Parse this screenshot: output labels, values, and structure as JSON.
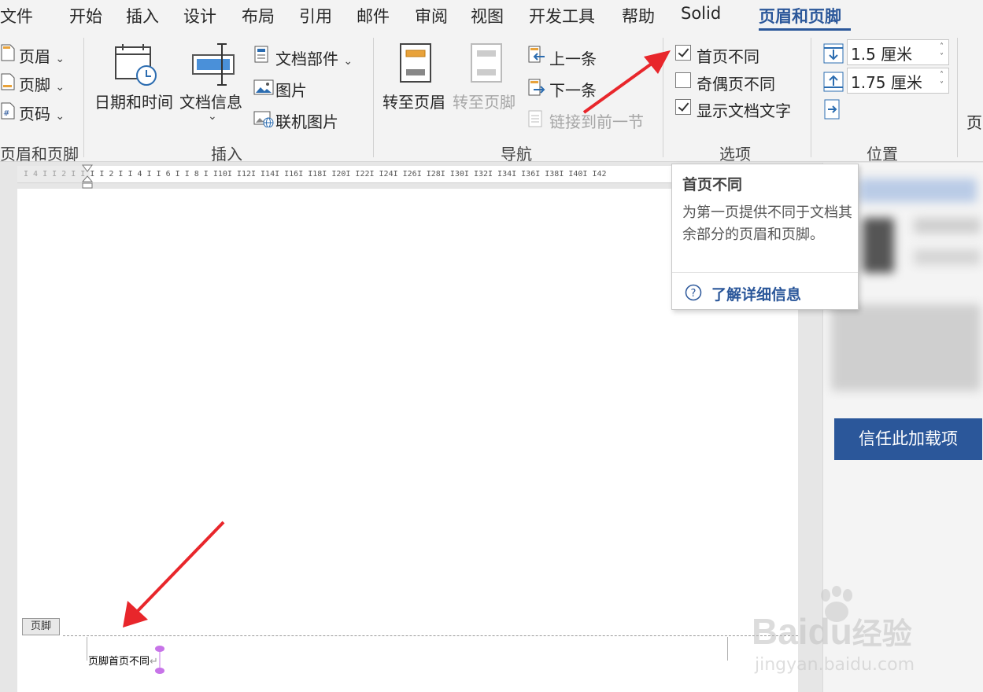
{
  "tabs": [
    {
      "label": "文件"
    },
    {
      "label": "开始"
    },
    {
      "label": "插入"
    },
    {
      "label": "设计"
    },
    {
      "label": "布局"
    },
    {
      "label": "引用"
    },
    {
      "label": "邮件"
    },
    {
      "label": "审阅"
    },
    {
      "label": "视图"
    },
    {
      "label": "开发工具"
    },
    {
      "label": "帮助"
    },
    {
      "label": "Solid"
    },
    {
      "label": "页眉和页脚",
      "active": true
    }
  ],
  "ribbon": {
    "hf_group": {
      "header": "页眉",
      "footer": "页脚",
      "page_number": "页码",
      "label": "页眉和页脚"
    },
    "insert_group": {
      "date_time": "日期和时间",
      "doc_info": "文档信息",
      "quick_parts": "文档部件",
      "picture": "图片",
      "online_picture": "联机图片",
      "label": "插入"
    },
    "nav_group": {
      "goto_header": "转至页眉",
      "goto_footer": "转至页脚",
      "previous": "上一条",
      "next": "下一条",
      "link_previous": "链接到前一节",
      "label": "导航"
    },
    "options_group": {
      "different_first": "首页不同",
      "different_odd_even": "奇偶页不同",
      "show_doc_text": "显示文档文字",
      "label": "选项"
    },
    "position_group": {
      "header_from_top": "1.5 厘米",
      "footer_from_bottom": "1.75 厘米",
      "label": "位置"
    },
    "close_partial": "页"
  },
  "options_state": {
    "different_first": true,
    "different_odd_even": false,
    "show_doc_text": true
  },
  "ruler": {
    "marks": "I 4 I   I 2 I   I   I   I 2 I   I 4 I   I 6 I   I 8 I   I10I   I12I   I14I   I16I   I18I   I20I   I22I   I24I   I26I   I28I   I30I   I32I   I34I   I36I   I38I   I40I   I42"
  },
  "document": {
    "footer_tag": "页脚",
    "footer_text": "页脚首页不同"
  },
  "tooltip": {
    "title": "首页不同",
    "description": "为第一页提供不同于文档其余部分的页眉和页脚。",
    "link": "了解详细信息"
  },
  "side_pane": {
    "trust_button": "信任此加载项"
  },
  "watermark": {
    "brand": "Bai",
    "brand2": "du",
    "cn": "经验",
    "url": "jingyan.baidu.com"
  },
  "colors": {
    "accent": "#2b579a",
    "arrow": "#e8262b",
    "ribbon_bg": "#f3f3f3"
  }
}
